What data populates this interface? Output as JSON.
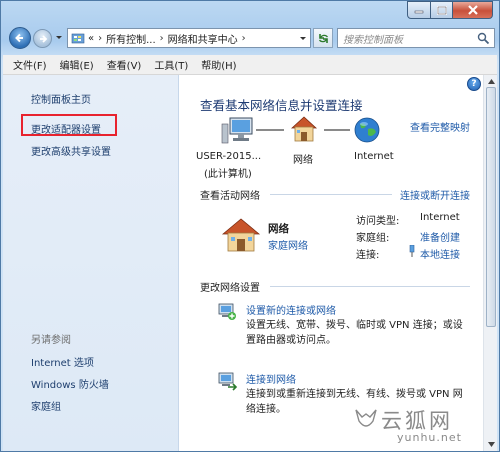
{
  "address": {
    "breadcrumbs": [
      "所有控制...",
      "网络和共享中心"
    ],
    "overflow": "«",
    "search_placeholder": "搜索控制面板"
  },
  "menu": [
    "文件(F)",
    "编辑(E)",
    "查看(V)",
    "工具(T)",
    "帮助(H)"
  ],
  "sidebar": {
    "links": [
      "控制面板主页",
      "更改适配器设置",
      "更改高级共享设置"
    ],
    "see_also_heading": "另请参阅",
    "see_also": [
      "Internet 选项",
      "Windows 防火墙",
      "家庭组"
    ]
  },
  "main": {
    "title": "查看基本网络信息并设置连接",
    "full_map_link": "查看完整映射",
    "diagram": {
      "computer": "USER-2015...",
      "computer_sub": "(此计算机)",
      "network": "网络",
      "internet": "Internet"
    },
    "active_heading": "查看活动网络",
    "connect_disconnect_link": "连接或断开连接",
    "active_network": {
      "name": "网络",
      "type": "家庭网络",
      "access_type_label": "访问类型:",
      "access_type_value": "Internet",
      "homegroup_label": "家庭组:",
      "homegroup_value": "准备创建",
      "connection_label": "连接:",
      "connection_value": "本地连接"
    },
    "change_heading": "更改网络设置",
    "tasks": [
      {
        "link": "设置新的连接或网络",
        "desc": "设置无线、宽带、拨号、临时或 VPN 连接；或设置路由器或访问点。"
      },
      {
        "link": "连接到网络",
        "desc": "连接到或重新连接到无线、有线、拨号或 VPN 网络连接。"
      }
    ]
  },
  "watermark": {
    "name": "云狐网",
    "url": "yunhu.net"
  },
  "colors": {
    "link": "#1e5aa8",
    "highlight_box": "#e8232e",
    "title": "#1e3b73"
  }
}
